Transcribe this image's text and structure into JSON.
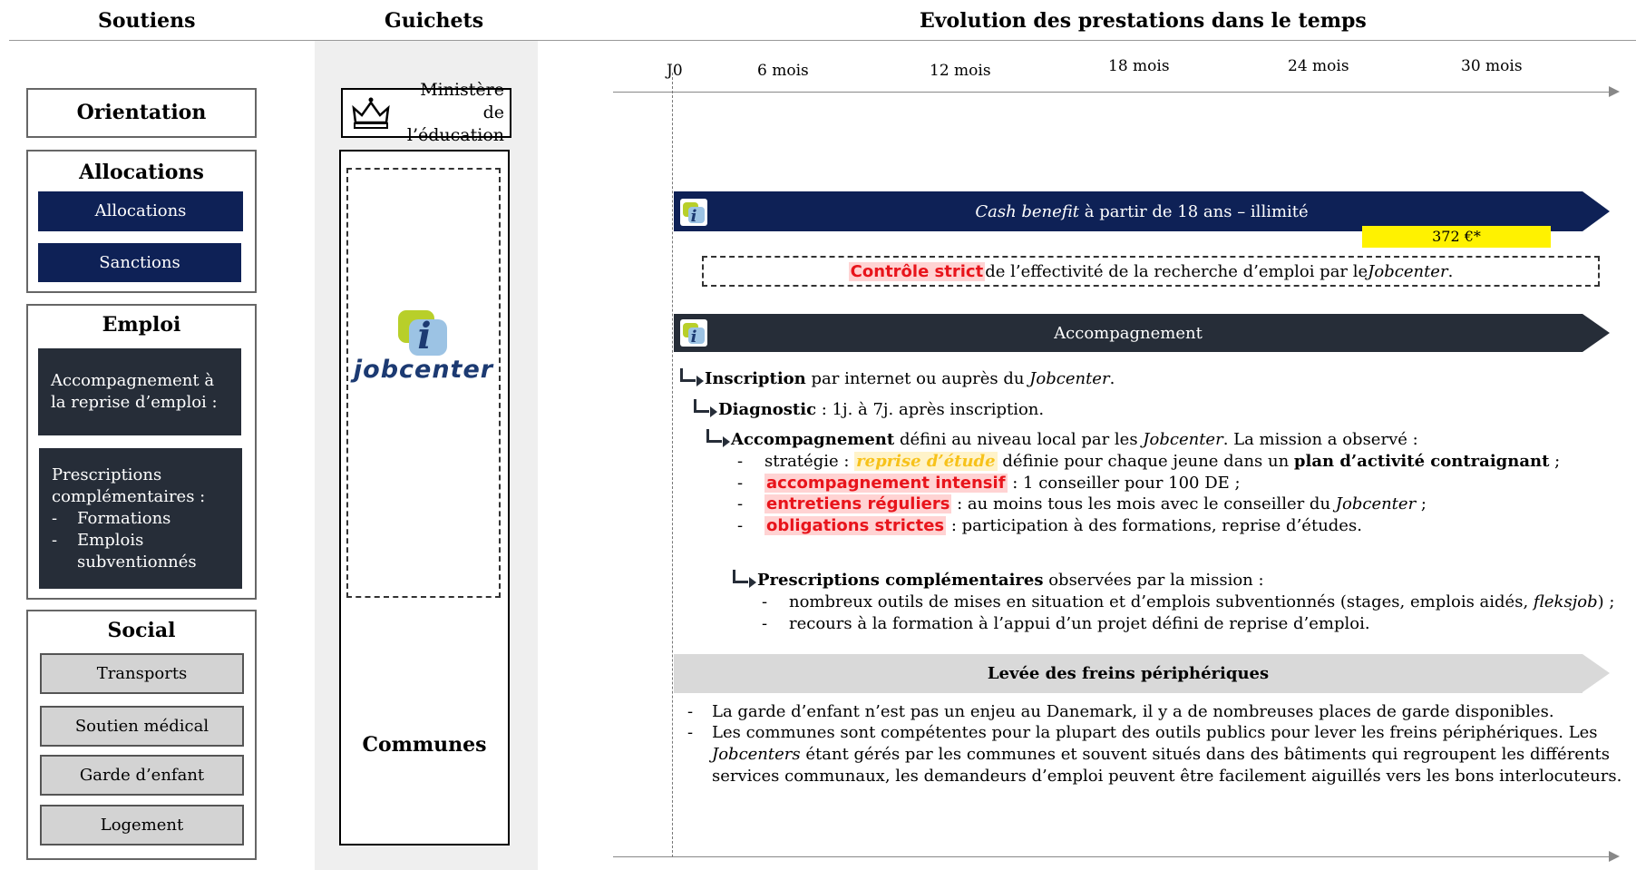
{
  "headers": {
    "soutiens": "Soutiens",
    "guichets": "Guichets",
    "evolution": "Evolution des prestations dans le temps"
  },
  "soutiens": {
    "orientation": "Orientation",
    "allocations": {
      "title": "Allocations",
      "items": [
        "Allocations",
        "Sanctions"
      ]
    },
    "emploi": {
      "title": "Emploi",
      "panel1": "Accompagnement à la reprise d’emploi :",
      "panel2_title": "Prescriptions complémentaires :",
      "panel2_items": [
        "Formations",
        "Emplois subventionnés"
      ]
    },
    "social": {
      "title": "Social",
      "items": [
        "Transports",
        "Soutien médical",
        "Garde d’enfant",
        "Logement"
      ]
    }
  },
  "guichets": {
    "ministere": "Ministère de l’éducation",
    "jobcenter_logo": "jobcenter",
    "communes": "Communes"
  },
  "timeline": {
    "ticks": [
      "J0",
      "6 mois",
      "12 mois",
      "18 mois",
      "24 mois",
      "30 mois"
    ]
  },
  "cash": {
    "banner_italic": "Cash benefit",
    "banner_rest": " à partir de 18 ans – illimité",
    "amount": "372 €*",
    "control_hl": "Contrôle strict",
    "control_mid": " de l’effectivité de la recherche d’emploi par le ",
    "control_it": "Jobcenter",
    "control_end": "."
  },
  "accomp": {
    "banner": "Accompagnement",
    "inscription_b": "Inscription",
    "inscription_rest": " par internet ou auprès du ",
    "inscription_it": "Jobcenter",
    "inscription_end": ".",
    "diagnostic_b": "Diagnostic",
    "diagnostic_rest": " : 1j. à 7j. après inscription.",
    "acc_b": "Accompagnement",
    "acc_rest": " défini au niveau local par les ",
    "acc_it": "Jobcenter",
    "acc_end": ". La mission a observé :",
    "b1_pre": "stratégie : ",
    "b1_hl": "reprise d’étude",
    "b1_mid": " définie pour chaque jeune dans un ",
    "b1_b": "plan d’activité contraignant",
    "b1_end": " ;",
    "b2_hl": "accompagnement intensif",
    "b2_rest": " : 1 conseiller pour 100 DE ;",
    "b3_hl": "entretiens réguliers",
    "b3_rest": " : au moins tous les mois avec le conseiller du ",
    "b3_it": "Jobcenter",
    "b3_end": " ;",
    "b4_hl": "obligations strictes",
    "b4_rest": " : participation à des formations, reprise d’études.",
    "presc_b": "Prescriptions complémentaires",
    "presc_rest": " observées par la mission :",
    "p1_pre": "nombreux outils de mises en situation et d’emplois subventionnés (stages, emplois aidés, ",
    "p1_it": "fleksjob",
    "p1_end": ") ;",
    "p2": "recours à la formation à l’appui d’un projet défini de reprise d’emploi."
  },
  "freins": {
    "banner": "Levée des freins périphériques",
    "l1": "La garde d’enfant n’est pas un enjeu au Danemark, il y a de nombreuses places de garde disponibles.",
    "l2": "Les communes sont compétentes pour la plupart des outils publics pour lever les freins périphériques. Les",
    "l3_it": "Jobcenters",
    "l3_rest": " étant gérés par les communes et souvent situés dans des bâtiments qui regroupent les différents",
    "l4": "services communaux, les demandeurs d’emploi peuvent être facilement aiguillés vers les bons interlocuteurs."
  },
  "colors": {
    "navy": "#0e2156",
    "dark": "#262d38",
    "yellow": "#fff200",
    "red": "#e8141b",
    "grey_banner": "#d9d9d9"
  }
}
